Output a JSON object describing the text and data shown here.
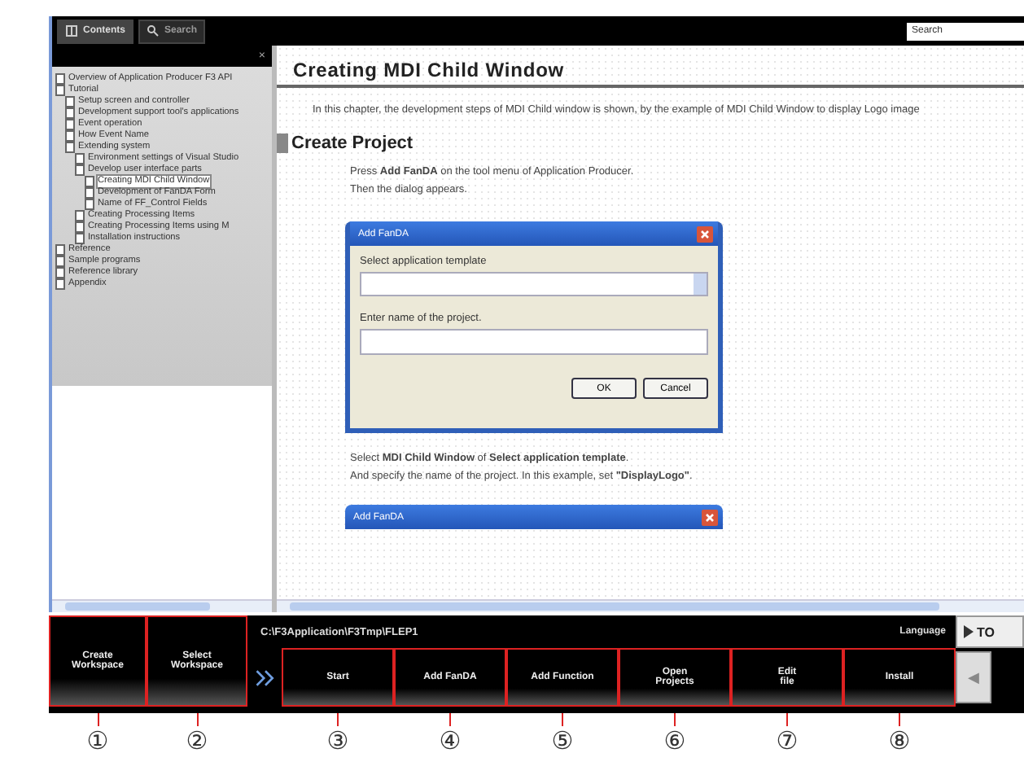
{
  "toolbar": {
    "tabs": [
      {
        "label": "Contents",
        "selected": true
      },
      {
        "label": "Search",
        "selected": false
      }
    ],
    "search": {
      "placeholder": "Search"
    }
  },
  "sidebar": {
    "close": "×",
    "tree": [
      {
        "label": "Overview of Application Producer F3 API",
        "selected": false
      },
      {
        "label": "Tutorial",
        "selected": false,
        "children": [
          {
            "label": "Setup screen and controller",
            "selected": false
          },
          {
            "label": "Development support tool's applications",
            "selected": false
          },
          {
            "label": "Event operation",
            "selected": false
          },
          {
            "label": "How Event Name",
            "selected": false
          },
          {
            "label": "Extending system",
            "selected": false,
            "children": [
              {
                "label": "Environment settings of Visual Studio",
                "selected": false
              },
              {
                "label": "Develop user interface parts",
                "selected": false,
                "children": [
                  {
                    "label": "Creating MDI Child Window",
                    "selected": true
                  },
                  {
                    "label": "Development of FanDA Form",
                    "selected": false
                  },
                  {
                    "label": "Name of FF_Control Fields",
                    "selected": false
                  }
                ]
              },
              {
                "label": "Creating Processing Items",
                "selected": false
              },
              {
                "label": "Creating Processing Items using M",
                "selected": false
              },
              {
                "label": "Installation instructions",
                "selected": false
              }
            ]
          }
        ]
      },
      {
        "label": "Reference",
        "selected": false
      },
      {
        "label": "Sample programs",
        "selected": false
      },
      {
        "label": "Reference library",
        "selected": false
      },
      {
        "label": "Appendix",
        "selected": false
      }
    ]
  },
  "content": {
    "title": "Creating MDI Child Window",
    "intro": "In this chapter, the development steps of MDI Child window is shown, by the example of MDI Child Window to display Logo image",
    "section": "Create Project",
    "steps": [
      "Press **Add FanDA** on the tool menu of Application Producer.",
      "Then the dialog appears."
    ],
    "dialog": {
      "title": "Add FanDA",
      "template_label": "Select application template",
      "name_label": "Enter name of the project.",
      "buttons": [
        "OK",
        "Cancel"
      ]
    },
    "after": [
      "Select **MDI Child Window** of **Select application template**.",
      "And specify the name of the project. In this example, set **\"DisplayLogo\"**."
    ],
    "next_dialog": {
      "title": "Add FanDA"
    }
  },
  "bottom_bar": {
    "path": "C:\\F3Application\\F3Tmp\\FLEP1",
    "language": "Language",
    "workspace_buttons": [
      "Create\nWorkspace",
      "Select\nWorkspace"
    ],
    "actions": [
      "Start",
      "Add FanDA",
      "Add Function",
      "Open\nProjects",
      "Edit\nfile",
      "Install"
    ],
    "top_button": "TO",
    "back_button": "◀"
  },
  "callouts": [
    "①",
    "②",
    "③",
    "④",
    "⑤",
    "⑥",
    "⑦",
    "⑧"
  ]
}
